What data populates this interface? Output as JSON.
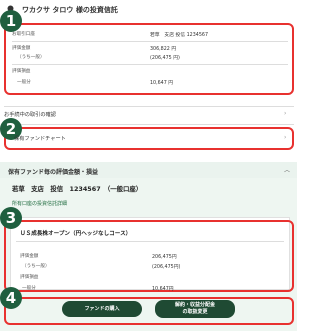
{
  "header": {
    "title": "ワカクサ タロウ 様の投資信託"
  },
  "badges": [
    "1",
    "2",
    "3",
    "4"
  ],
  "summary": {
    "account_label": "お取引口座",
    "account_value": "若草　支店 投信 1234567",
    "valuation_label": "評価金額",
    "valuation_value": "306,822 円",
    "general_label": "（うち一般）",
    "general_value": "(206,475 円)",
    "pl_label": "評価損益",
    "pl_sub_label": "一般分",
    "pl_value": "10,647 円"
  },
  "links": {
    "pending": "お手続中の取引の確認",
    "chart": "保有ファンドチャート"
  },
  "fund_section": {
    "header": "保有ファンド毎の評価金額・損益",
    "account_line": "若草　支店　投信　1234567　（一般口座）",
    "detail_link": "所有口座の投資信託詳細"
  },
  "fund_card": {
    "name": "ＵＳ成長株オープン（円ヘッジなしコース）",
    "valuation_label": "評価金額",
    "valuation_value": "206,475円",
    "general_label": "（うち一般）",
    "general_value": "(206,475円)",
    "pl_label": "評価損益",
    "pl_sub_label": "一般分",
    "pl_value": "10,647円"
  },
  "buttons": {
    "buy": "ファンドの購入",
    "sell_line1": "解約・収益分配金",
    "sell_line2": "の取扱変更"
  },
  "colors": {
    "accent_green": "#1f5f3f",
    "highlight_red": "#e8312f",
    "panel_bg": "#eef6f1"
  }
}
